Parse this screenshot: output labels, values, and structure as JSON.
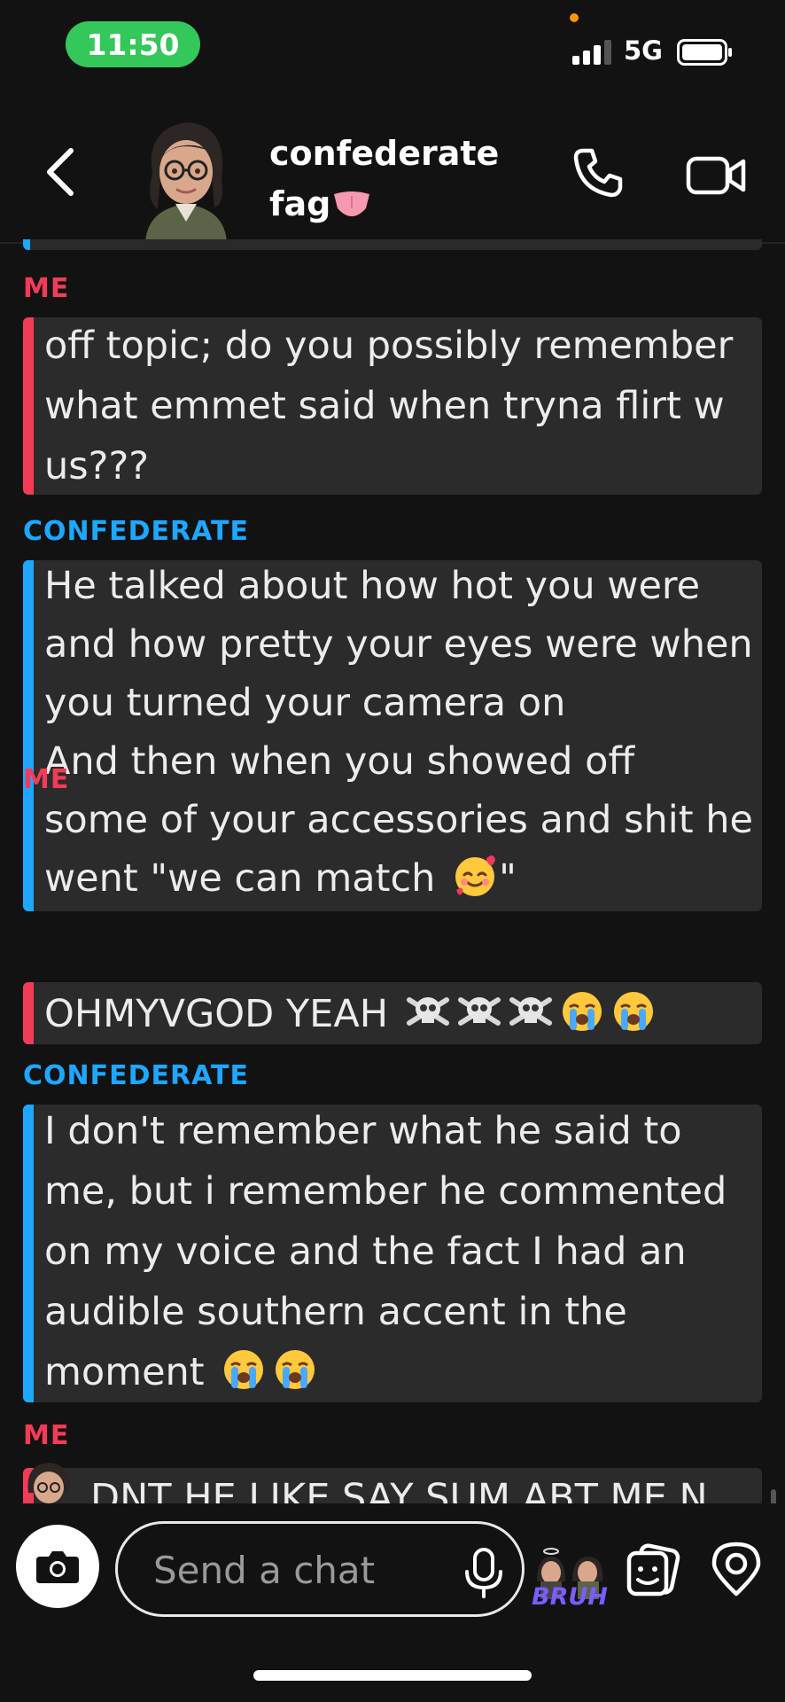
{
  "status_bar": {
    "time": "11:50",
    "network": "5G"
  },
  "header": {
    "contact_name_line1": "confederate",
    "contact_name_line2": "fag"
  },
  "messages": [
    {
      "sender": "ME",
      "lines": [
        "off topic; do you possibly remember",
        "what emmet said when tryna flirt w",
        "us???"
      ]
    },
    {
      "sender": "CONFEDERATE",
      "lines": [
        "He talked about how hot you were",
        "and how pretty your eyes were when",
        "you turned your camera on",
        "And then when you showed off",
        "some of your accessories and shit he",
        "went \"we can match "
      ],
      "line6_suffix": "\""
    },
    {
      "sender": "ME",
      "lines": [
        "OHMYVGOD YEAH "
      ]
    },
    {
      "sender": "CONFEDERATE",
      "lines": [
        "I don't remember what he said to",
        "me, but i remember he commented",
        "on my voice and the fact I had an",
        "audible southern accent in the",
        "moment "
      ]
    },
    {
      "sender": "ME",
      "lines": [
        "DNT HE LIKE SAY SUM ABT ME N"
      ]
    }
  ],
  "composer": {
    "placeholder": "Send a chat",
    "sticker_caption": "BRUH"
  },
  "colors": {
    "me": "#f23c57",
    "them": "#1ea7ff",
    "time_pill": "#34c759",
    "background": "#121212"
  },
  "icons": [
    "back-icon",
    "call-icon",
    "video-call-icon",
    "camera-icon",
    "microphone-icon",
    "sticker-icon",
    "location-icon"
  ]
}
